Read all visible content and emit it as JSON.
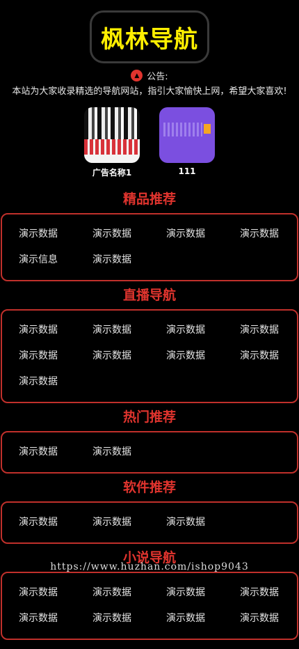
{
  "site": {
    "logo_text": "枫林导航",
    "notice_label": "公告:",
    "notice_text": "本站为大家收录精选的导航网站，指引大家愉快上网，希望大家喜欢!"
  },
  "ads": [
    {
      "label": "广告名称1"
    },
    {
      "label": "111"
    }
  ],
  "sections": [
    {
      "title": "精品推荐",
      "items": [
        "演示数据",
        "演示数据",
        "演示数据",
        "演示数据",
        "演示信息",
        "演示数据"
      ]
    },
    {
      "title": "直播导航",
      "items": [
        "演示数据",
        "演示数据",
        "演示数据",
        "演示数据",
        "演示数据",
        "演示数据",
        "演示数据",
        "演示数据",
        "演示数据"
      ]
    },
    {
      "title": "热门推荐",
      "items": [
        "演示数据",
        "演示数据"
      ]
    },
    {
      "title": "软件推荐",
      "items": [
        "演示数据",
        "演示数据",
        "演示数据"
      ]
    },
    {
      "title": "小说导航",
      "items": [
        "演示数据",
        "演示数据",
        "演示数据",
        "演示数据",
        "演示数据",
        "演示数据",
        "演示数据",
        "演示数据"
      ]
    }
  ],
  "watermark": "https://www.huzhan.com/ishop9043",
  "colors": {
    "accent": "#e0342e",
    "logo": "#ffef00",
    "border": "#c0302b"
  }
}
